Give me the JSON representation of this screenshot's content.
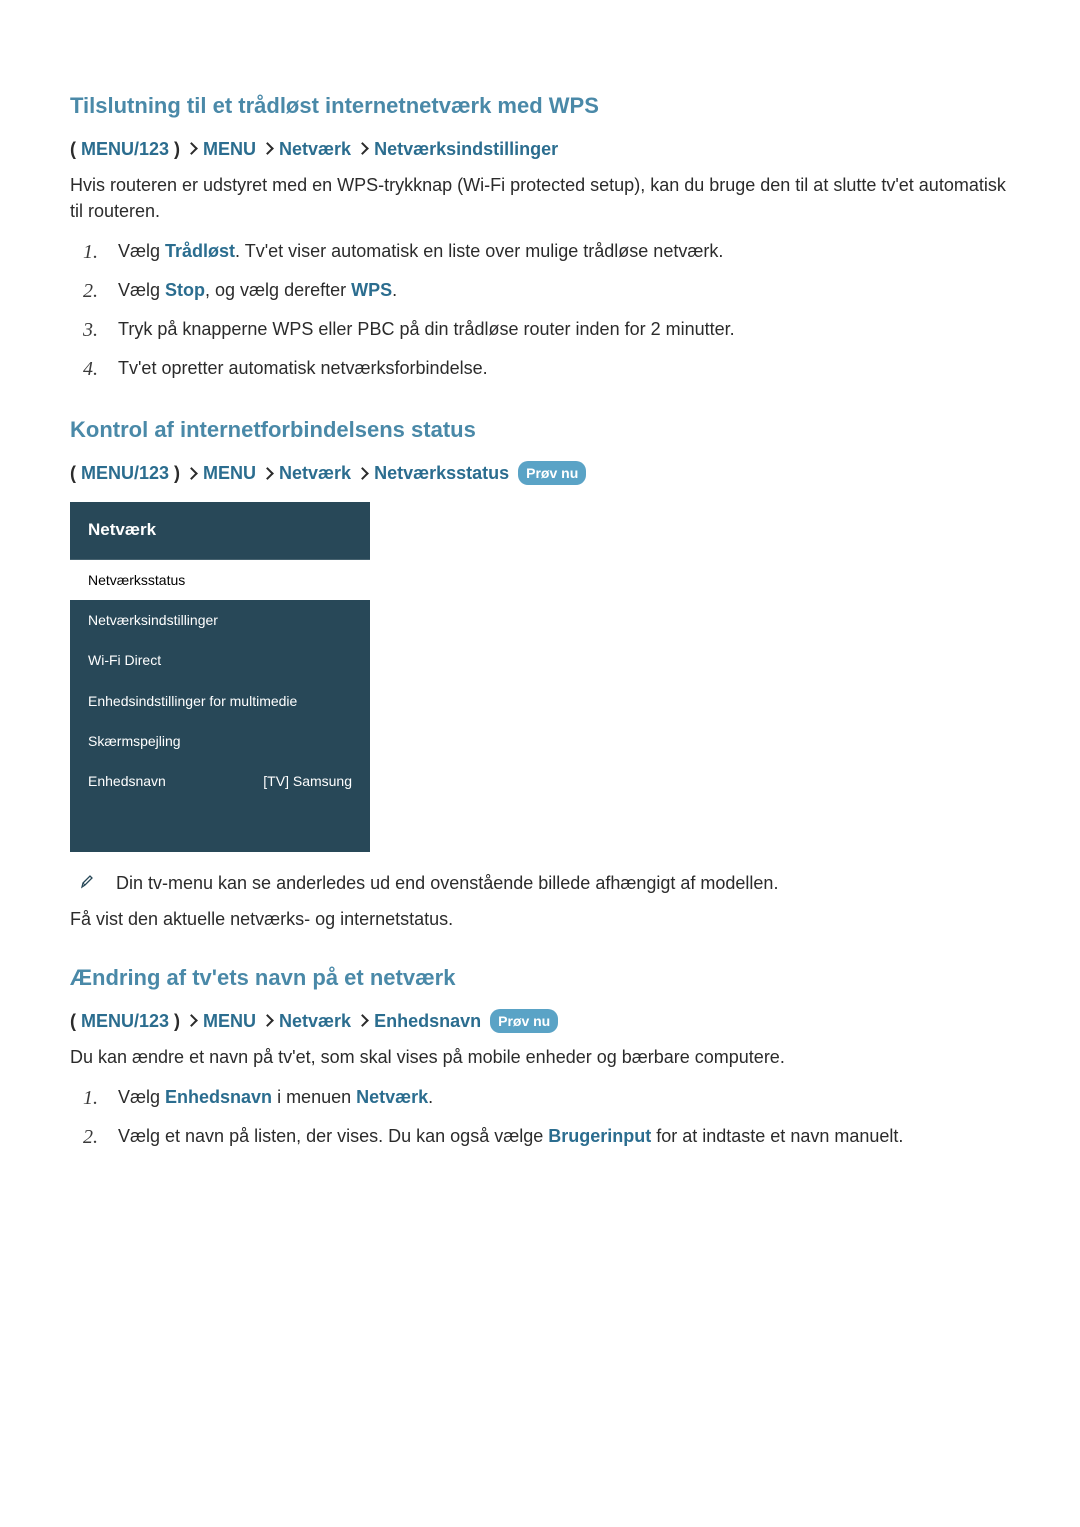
{
  "section1": {
    "title": "Tilslutning til et trådløst internetnetværk med WPS",
    "breadcrumb": {
      "p0": "MENU/123",
      "p1": "MENU",
      "p2": "Netværk",
      "p3": "Netværksindstillinger"
    },
    "intro": "Hvis routeren er udstyret med en WPS-trykknap (Wi-Fi protected setup), kan du bruge den til at slutte tv'et automatisk til routeren.",
    "steps": {
      "s1_a": "Vælg ",
      "s1_kw": "Trådløst",
      "s1_b": ". Tv'et viser automatisk en liste over mulige trådløse netværk.",
      "s2_a": "Vælg ",
      "s2_kw1": "Stop",
      "s2_b": ", og vælg derefter ",
      "s2_kw2": "WPS",
      "s2_c": ".",
      "s3": "Tryk på knapperne WPS eller PBC på din trådløse router inden for 2 minutter.",
      "s4": "Tv'et opretter automatisk netværksforbindelse."
    }
  },
  "section2": {
    "title": "Kontrol af internetforbindelsens status",
    "breadcrumb": {
      "p0": "MENU/123",
      "p1": "MENU",
      "p2": "Netværk",
      "p3": "Netværksstatus",
      "badge": "Prøv nu"
    },
    "menu": {
      "header": "Netværk",
      "items": [
        {
          "label": "Netværksstatus",
          "value": ""
        },
        {
          "label": "Netværksindstillinger",
          "value": ""
        },
        {
          "label": "Wi-Fi Direct",
          "value": ""
        },
        {
          "label": "Enhedsindstillinger for multimedie",
          "value": ""
        },
        {
          "label": "Skærmspejling",
          "value": ""
        },
        {
          "label": "Enhedsnavn",
          "value": "[TV] Samsung"
        }
      ]
    },
    "note": "Din tv-menu kan se anderledes ud end ovenstående billede afhængigt af modellen.",
    "desc": "Få vist den aktuelle netværks- og internetstatus."
  },
  "section3": {
    "title": "Ændring af tv'ets navn på et netværk",
    "breadcrumb": {
      "p0": "MENU/123",
      "p1": "MENU",
      "p2": "Netværk",
      "p3": "Enhedsnavn",
      "badge": "Prøv nu"
    },
    "intro": "Du kan ændre et navn på tv'et, som skal vises på mobile enheder og bærbare computere.",
    "steps": {
      "s1_a": "Vælg ",
      "s1_kw1": "Enhedsnavn",
      "s1_b": " i menuen ",
      "s1_kw2": "Netværk",
      "s1_c": ".",
      "s2_a": "Vælg et navn på listen, der vises. Du kan også vælge ",
      "s2_kw": "Brugerinput",
      "s2_b": " for at indtaste et navn manuelt."
    }
  },
  "nums": {
    "n1": "1.",
    "n2": "2.",
    "n3": "3.",
    "n4": "4."
  }
}
